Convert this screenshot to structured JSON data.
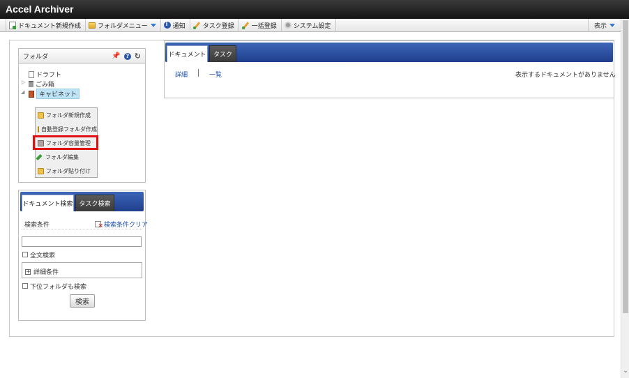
{
  "app": {
    "title": "Accel Archiver"
  },
  "toolbar": {
    "items": [
      {
        "label": "ドキュメント新規作成",
        "icon": "document-new-icon"
      },
      {
        "label": "フォルダメニュー",
        "icon": "folder-icon"
      },
      {
        "label": "通知",
        "icon": "info-icon"
      },
      {
        "label": "タスク登録",
        "icon": "pencil-icon"
      },
      {
        "label": "一括登録",
        "icon": "pencil-icon"
      },
      {
        "label": "システム設定",
        "icon": "gear-icon"
      }
    ],
    "display_label": "表示"
  },
  "folder_panel": {
    "title": "フォルダ",
    "tree": [
      {
        "label": "ドラフト",
        "icon": "draft-icon"
      },
      {
        "label": "ごみ箱",
        "icon": "trash-icon"
      },
      {
        "label": "キャビネット",
        "icon": "cabinet-icon",
        "selected": true
      }
    ],
    "context_menu": [
      {
        "label": "フォルダ新規作成",
        "icon": "folder-add-icon"
      },
      {
        "label": "自動登録フォルダ作成",
        "icon": "auto-folder-icon"
      },
      {
        "label": "フォルダ容量管理",
        "icon": "capacity-icon",
        "highlighted": true
      },
      {
        "label": "フォルダ編集",
        "icon": "edit-icon"
      },
      {
        "label": "フォルダ貼り付け",
        "icon": "paste-icon"
      }
    ]
  },
  "search_panel": {
    "tabs": [
      "ドキュメント検索",
      "タスク検索"
    ],
    "condition_label": "検索条件",
    "clear_label": "検索条件クリア",
    "input_value": "",
    "fulltext_label": "全文検索",
    "detail_label": "詳細条件",
    "subfolder_label": "下位フォルダも検索",
    "search_button": "検索"
  },
  "content_panel": {
    "tabs": [
      "ドキュメント",
      "タスク"
    ],
    "links": [
      "詳細",
      "一覧"
    ],
    "empty_message": "表示するドキュメントがありません"
  },
  "colors": {
    "tab_bar": "#2a4e9f",
    "highlight": "#e01010",
    "link": "#1a4fa8"
  }
}
